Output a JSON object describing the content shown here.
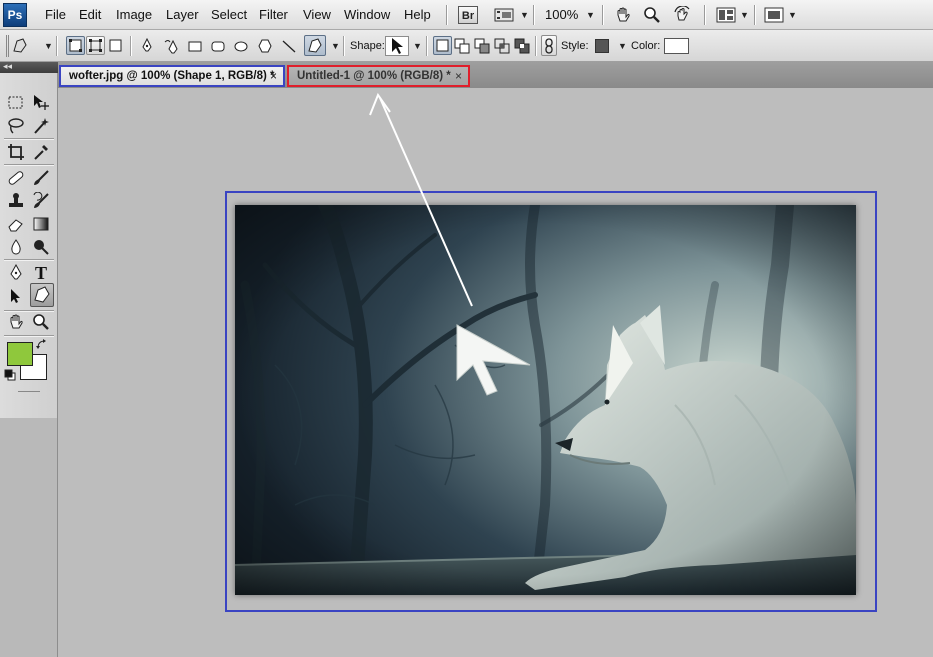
{
  "app": {
    "logo": "Ps"
  },
  "menu": {
    "items": [
      "File",
      "Edit",
      "Image",
      "Layer",
      "Select",
      "Filter",
      "View",
      "Window",
      "Help"
    ],
    "bridge_label": "Br",
    "zoom": "100%"
  },
  "options": {
    "shape_label": "Shape:",
    "style_label": "Style:",
    "color_label": "Color:",
    "style_color": "#555555",
    "fill_color": "#ffffff"
  },
  "tabs": [
    {
      "title": "wofter.jpg @ 100% (Shape 1, RGB/8) *",
      "close": "×",
      "active": true
    },
    {
      "title": "Untitled-1 @ 100% (RGB/8) *",
      "close": "×",
      "active": false
    }
  ],
  "toolbox": {
    "type_tool": "T",
    "foreground": "#8fc83c",
    "background": "#ffffff"
  },
  "colors": {
    "accent_blue": "#3a44c2",
    "accent_red": "#e01e2b"
  }
}
